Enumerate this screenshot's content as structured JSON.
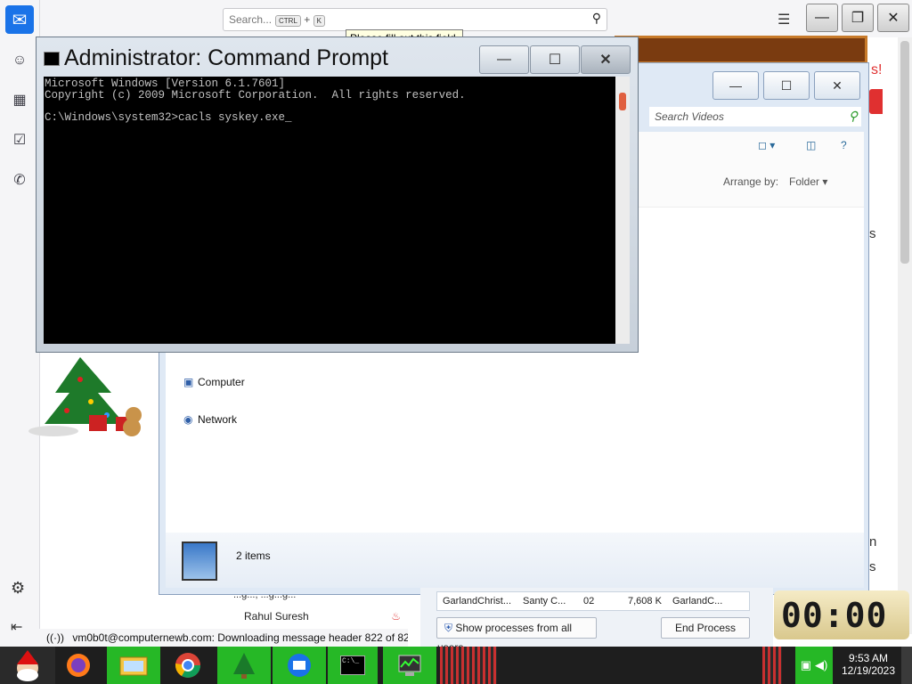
{
  "thunderbird": {
    "search_placeholder": "Search...",
    "key1": "CTRL",
    "plus": "+",
    "key2": "K",
    "tooltip": "Please fill out this field.",
    "status_text": "vm0b0t@computernewb.com: Downloading message header 822 of 82",
    "mail_sender": "Rahul Suresh",
    "mail_prev": "...g..., ...g...g..."
  },
  "explorer": {
    "search_placeholder": "Search Videos",
    "arrange_label": "Arrange by:",
    "arrange_value": "Folder",
    "nav_items": [
      "Computer",
      "Network"
    ],
    "item_count": "2 items"
  },
  "background_fragments": {
    "exclaim": "s!",
    "s1": "s",
    "n": "n",
    "s2": "s"
  },
  "task_manager": {
    "row": [
      "GarlandChrist...",
      "Santy C...",
      "02",
      "7,608 K",
      "GarlandC..."
    ],
    "show_all_label": "Show processes from all users",
    "end_process_label": "End Process"
  },
  "clock_gadget": {
    "display": "00:00"
  },
  "cmd": {
    "title": "Administrator: Command Prompt",
    "lines": [
      "Microsoft Windows [Version 6.1.7601]",
      "Copyright (c) 2009 Microsoft Corporation.  All rights reserved.",
      "",
      "C:\\Windows\\system32>cacls syskey.exe_"
    ]
  },
  "taskbar": {
    "time": "9:53 AM",
    "date": "12/19/2023",
    "cmd_icon_text": "C:\\_"
  }
}
